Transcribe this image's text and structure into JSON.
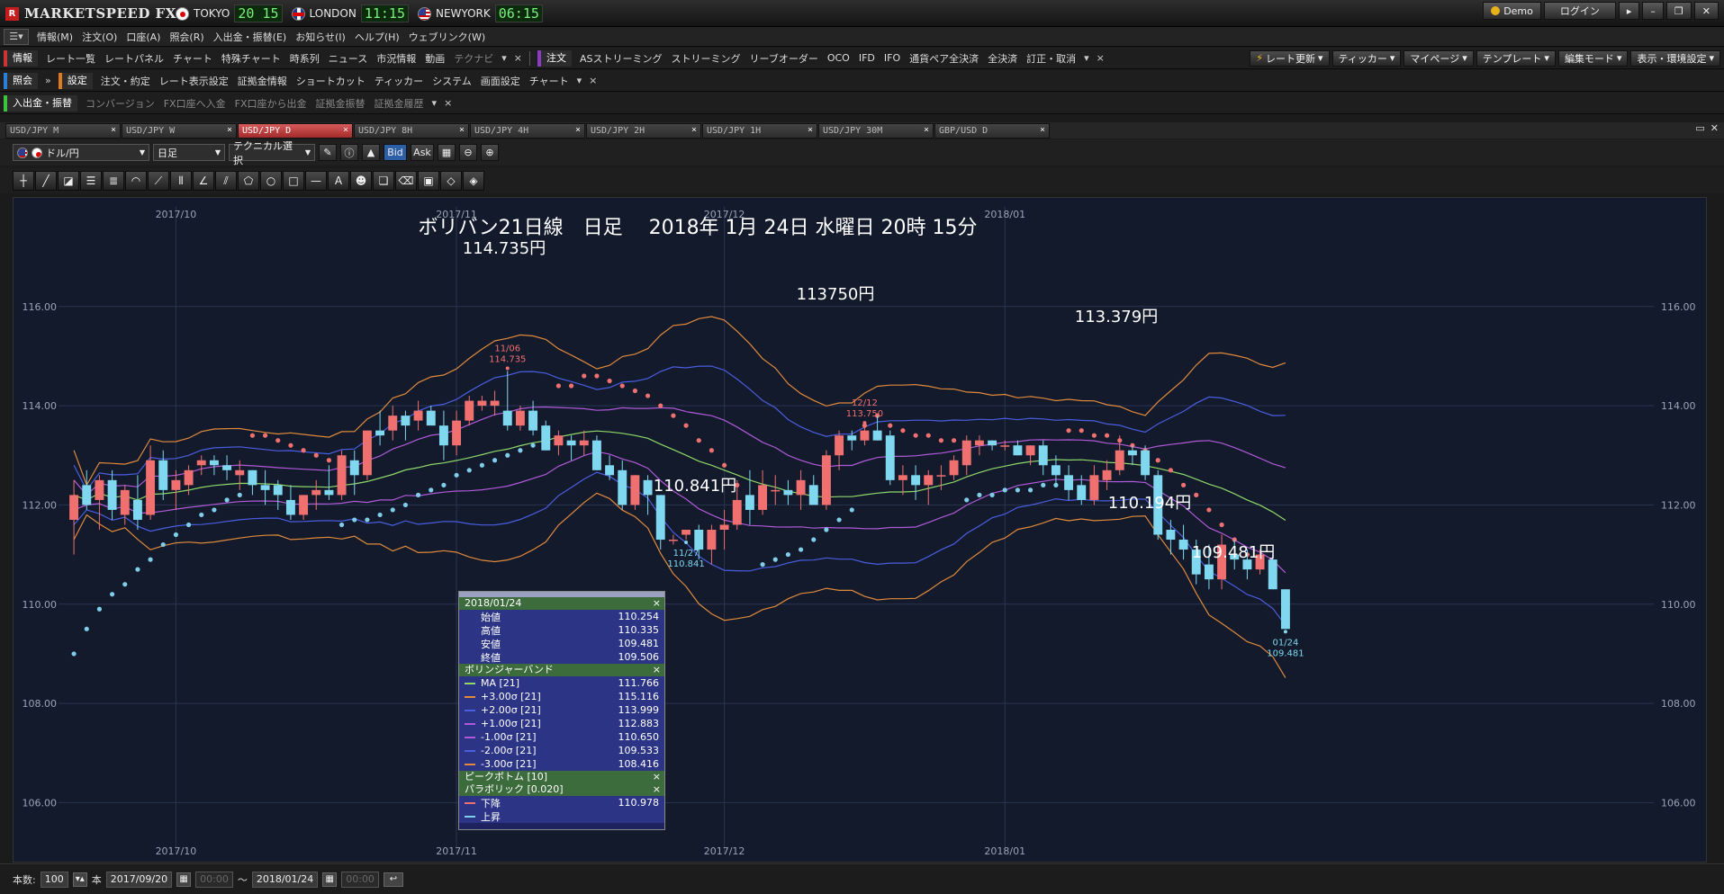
{
  "app": {
    "logo_text": "MARKETSPEED FX",
    "clocks": [
      {
        "name": "TOKYO",
        "time": "20 15"
      },
      {
        "name": "LONDON",
        "time": "11:15"
      },
      {
        "name": "NEWYORK",
        "time": "06:15"
      }
    ],
    "demo_label": "Demo",
    "login_label": "ログイン"
  },
  "menu": [
    "情報(M)",
    "注文(O)",
    "口座(A)",
    "照会(R)",
    "入出金・振替(E)",
    "お知らせ(I)",
    "ヘルプ(H)",
    "ウェブリンク(W)"
  ],
  "toolbar1": {
    "group1_label": "情報",
    "group1_items": [
      "レート一覧",
      "レートパネル",
      "チャート",
      "特殊チャート",
      "時系列",
      "ニュース",
      "市況情報",
      "動画"
    ],
    "group1_dim": "テクナビ",
    "group2_label": "注文",
    "group2_items": [
      "ASストリーミング",
      "ストリーミング",
      "リーブオーダー",
      "OCO",
      "IFD",
      "IFO",
      "通貨ペア全決済",
      "全決済",
      "訂正・取消"
    ],
    "right_buttons": [
      "レート更新",
      "ティッカー",
      "マイページ",
      "テンプレート",
      "編集モード",
      "表示・環境設定"
    ]
  },
  "toolbar2": {
    "group1_label": "照会",
    "group2_label": "設定",
    "group2_items": [
      "注文・約定",
      "レート表示設定",
      "証拠金情報",
      "ショートカット",
      "ティッカー",
      "システム",
      "画面設定",
      "チャート"
    ]
  },
  "toolbar3": {
    "group1_label": "入出金・振替",
    "items": [
      "コンバージョン",
      "FX口座へ入金",
      "FX口座から出金",
      "証拠金振替",
      "証拠金履歴"
    ]
  },
  "tabs": [
    {
      "label": "USD/JPY M",
      "active": false
    },
    {
      "label": "USD/JPY W",
      "active": false
    },
    {
      "label": "USD/JPY D",
      "active": true
    },
    {
      "label": "USD/JPY 8H",
      "active": false
    },
    {
      "label": "USD/JPY 4H",
      "active": false
    },
    {
      "label": "USD/JPY 2H",
      "active": false
    },
    {
      "label": "USD/JPY 1H",
      "active": false
    },
    {
      "label": "USD/JPY 30M",
      "active": false
    },
    {
      "label": "GBP/USD D",
      "active": false
    }
  ],
  "chart_toolbar": {
    "pair": "ドル/円",
    "period": "日足",
    "technical": "テクニカル選択",
    "bid": "Bid",
    "ask": "Ask"
  },
  "status_bar": {
    "count_label": "本数:",
    "count_value": "100",
    "unit": "本",
    "date_from": "2017/09/20",
    "date_to": "2018/01/24",
    "time_from": "00:00",
    "time_to": "00:00",
    "tilde": "〜"
  },
  "data_panel": {
    "date": "2018/01/24",
    "ohlc": [
      {
        "label": "始値",
        "value": "110.254"
      },
      {
        "label": "高値",
        "value": "110.335"
      },
      {
        "label": "安値",
        "value": "109.481"
      },
      {
        "label": "終値",
        "value": "109.506"
      }
    ],
    "bb_title": "ボリンジャーバンド",
    "bb": [
      {
        "label": "MA [21]",
        "value": "111.766",
        "color": "#8fd86a"
      },
      {
        "label": "+3.00σ [21]",
        "value": "115.116",
        "color": "#e08a3c"
      },
      {
        "label": "+2.00σ [21]",
        "value": "113.999",
        "color": "#4a5ee0"
      },
      {
        "label": "+1.00σ [21]",
        "value": "112.883",
        "color": "#b05ad8"
      },
      {
        "label": "-1.00σ [21]",
        "value": "110.650",
        "color": "#b05ad8"
      },
      {
        "label": "-2.00σ [21]",
        "value": "109.533",
        "color": "#4a5ee0"
      },
      {
        "label": "-3.00σ [21]",
        "value": "108.416",
        "color": "#e08a3c"
      }
    ],
    "pb_title": "ピークボトム [10]",
    "sar_title": "パラボリック [0.020]",
    "sar": [
      {
        "label": "下降",
        "value": "110.978",
        "color": "#f07070"
      },
      {
        "label": "上昇",
        "value": "",
        "color": "#7fcde8"
      }
    ]
  },
  "chart_data": {
    "type": "candlestick",
    "title": "ボリバン21日線　日足　 2018年 1月 24日 水曜日 20時 15分",
    "ylim": [
      105.5,
      117.5
    ],
    "yticks": [
      "116.00",
      "114.00",
      "112.00",
      "110.00",
      "108.00",
      "106.00"
    ],
    "xticks": [
      "2017/10",
      "2017/11",
      "2017/12",
      "2018/01"
    ],
    "annotations": [
      {
        "text": "114.735円"
      },
      {
        "text": "113750円"
      },
      {
        "text": "113.379円"
      },
      {
        "text": "110.841円"
      },
      {
        "text": "110.194円"
      },
      {
        "text": "109.481円"
      }
    ],
    "markers": [
      {
        "date": "11/06",
        "value": "114.735"
      },
      {
        "date": "12/12",
        "value": "113.750"
      },
      {
        "date": "11/27",
        "value": "110.841"
      },
      {
        "date": "01/24",
        "value": "109.481"
      }
    ],
    "candles": [
      [
        111.7,
        112.5,
        111.0,
        112.2
      ],
      [
        112.4,
        112.7,
        111.9,
        112.0
      ],
      [
        112.1,
        112.6,
        111.5,
        112.5
      ],
      [
        112.5,
        112.7,
        111.7,
        111.9
      ],
      [
        111.8,
        112.4,
        111.6,
        112.3
      ],
      [
        112.1,
        112.6,
        111.5,
        111.7
      ],
      [
        111.8,
        113.2,
        111.7,
        112.9
      ],
      [
        112.9,
        113.1,
        112.1,
        112.3
      ],
      [
        112.3,
        112.7,
        111.9,
        112.5
      ],
      [
        112.4,
        112.8,
        112.2,
        112.7
      ],
      [
        112.8,
        113.0,
        112.6,
        112.9
      ],
      [
        112.9,
        113.0,
        112.6,
        112.8
      ],
      [
        112.8,
        113.0,
        112.5,
        112.7
      ],
      [
        112.6,
        112.9,
        112.3,
        112.7
      ],
      [
        112.7,
        112.7,
        112.2,
        112.4
      ],
      [
        112.4,
        112.7,
        112.0,
        112.3
      ],
      [
        112.4,
        112.5,
        111.9,
        112.2
      ],
      [
        112.1,
        112.4,
        111.7,
        111.8
      ],
      [
        111.8,
        112.2,
        111.7,
        112.2
      ],
      [
        112.2,
        112.5,
        111.9,
        112.3
      ],
      [
        112.3,
        112.8,
        112.1,
        112.2
      ],
      [
        112.2,
        113.1,
        112.1,
        113.0
      ],
      [
        112.9,
        113.1,
        112.2,
        112.6
      ],
      [
        112.6,
        113.5,
        112.5,
        113.5
      ],
      [
        113.5,
        113.9,
        113.2,
        113.4
      ],
      [
        113.5,
        114.0,
        113.3,
        113.8
      ],
      [
        113.8,
        113.9,
        113.3,
        113.6
      ],
      [
        113.7,
        114.1,
        113.5,
        113.9
      ],
      [
        113.9,
        114.0,
        113.7,
        113.6
      ],
      [
        113.6,
        113.9,
        112.9,
        113.2
      ],
      [
        113.2,
        113.9,
        113.0,
        113.7
      ],
      [
        113.7,
        114.2,
        113.6,
        114.1
      ],
      [
        114.0,
        114.2,
        113.9,
        114.1
      ],
      [
        114.0,
        114.3,
        113.8,
        114.1
      ],
      [
        113.9,
        114.7,
        113.5,
        113.6
      ],
      [
        113.6,
        114.0,
        113.5,
        113.9
      ],
      [
        113.9,
        114.1,
        113.4,
        113.5
      ],
      [
        113.6,
        113.7,
        113.1,
        113.1
      ],
      [
        113.2,
        113.5,
        113.0,
        113.4
      ],
      [
        113.3,
        113.4,
        112.9,
        113.2
      ],
      [
        113.2,
        113.5,
        113.0,
        113.3
      ],
      [
        113.3,
        113.4,
        112.7,
        112.7
      ],
      [
        112.8,
        113.0,
        112.5,
        112.6
      ],
      [
        112.7,
        112.9,
        111.9,
        112.0
      ],
      [
        112.0,
        112.6,
        111.9,
        112.6
      ],
      [
        112.5,
        112.6,
        111.8,
        112.2
      ],
      [
        112.2,
        112.2,
        111.1,
        111.3
      ],
      [
        111.3,
        111.4,
        111.2,
        111.3
      ],
      [
        111.4,
        111.5,
        111.3,
        111.5
      ],
      [
        111.5,
        111.6,
        110.9,
        111.1
      ],
      [
        111.1,
        111.6,
        110.8,
        111.5
      ],
      [
        111.5,
        111.9,
        111.1,
        111.6
      ],
      [
        111.6,
        112.5,
        111.5,
        112.1
      ],
      [
        112.2,
        112.7,
        111.6,
        111.9
      ],
      [
        111.9,
        112.7,
        111.8,
        112.4
      ],
      [
        112.3,
        112.6,
        112.0,
        112.3
      ],
      [
        112.3,
        112.5,
        112.0,
        112.2
      ],
      [
        112.2,
        112.7,
        111.9,
        112.5
      ],
      [
        112.4,
        112.6,
        112.0,
        112.0
      ],
      [
        112.0,
        113.1,
        111.9,
        113.0
      ],
      [
        113.0,
        113.5,
        112.7,
        113.4
      ],
      [
        113.4,
        113.5,
        113.1,
        113.3
      ],
      [
        113.3,
        113.6,
        113.2,
        113.5
      ],
      [
        113.5,
        113.8,
        113.3,
        113.3
      ],
      [
        113.4,
        113.5,
        112.4,
        112.5
      ],
      [
        112.5,
        112.8,
        112.2,
        112.6
      ],
      [
        112.6,
        112.8,
        112.1,
        112.4
      ],
      [
        112.4,
        112.7,
        112.0,
        112.6
      ],
      [
        112.6,
        112.8,
        112.3,
        112.6
      ],
      [
        112.6,
        113.0,
        112.5,
        112.9
      ],
      [
        112.8,
        113.4,
        112.6,
        113.3
      ],
      [
        113.2,
        113.4,
        113.0,
        113.3
      ],
      [
        113.3,
        113.3,
        113.1,
        113.2
      ],
      [
        113.2,
        113.3,
        113.1,
        113.2
      ],
      [
        113.2,
        113.3,
        113.0,
        113.0
      ],
      [
        113.0,
        113.2,
        112.8,
        113.2
      ],
      [
        113.2,
        113.3,
        112.6,
        112.8
      ],
      [
        112.8,
        113.0,
        112.4,
        112.6
      ],
      [
        112.6,
        112.8,
        112.1,
        112.3
      ],
      [
        112.4,
        112.6,
        112.0,
        112.1
      ],
      [
        112.1,
        112.8,
        112.0,
        112.6
      ],
      [
        112.5,
        112.9,
        112.3,
        112.7
      ],
      [
        112.7,
        113.4,
        112.6,
        113.1
      ],
      [
        113.1,
        113.2,
        112.8,
        113.0
      ],
      [
        113.1,
        113.2,
        112.5,
        112.6
      ],
      [
        112.6,
        112.7,
        111.3,
        111.4
      ],
      [
        111.5,
        111.7,
        111.0,
        111.3
      ],
      [
        111.3,
        111.6,
        110.9,
        111.1
      ],
      [
        111.1,
        111.3,
        110.4,
        110.6
      ],
      [
        110.8,
        111.2,
        110.3,
        110.5
      ],
      [
        110.5,
        111.4,
        110.3,
        111.2
      ],
      [
        111.0,
        111.3,
        110.7,
        110.9
      ],
      [
        110.9,
        111.1,
        110.5,
        110.7
      ],
      [
        110.7,
        111.1,
        110.6,
        111.0
      ],
      [
        110.9,
        111.0,
        110.3,
        110.3
      ],
      [
        110.3,
        110.3,
        109.5,
        109.5
      ]
    ],
    "sar_points": [
      [
        0,
        109.0
      ],
      [
        1,
        109.5
      ],
      [
        2,
        109.9
      ],
      [
        3,
        110.2
      ],
      [
        4,
        110.4
      ],
      [
        5,
        110.7
      ],
      [
        6,
        110.9
      ],
      [
        7,
        111.2
      ],
      [
        8,
        111.4
      ],
      [
        9,
        111.6
      ],
      [
        10,
        111.8
      ],
      [
        11,
        111.9
      ],
      [
        12,
        112.1
      ],
      [
        13,
        112.2
      ],
      [
        14,
        113.4
      ],
      [
        15,
        113.4
      ],
      [
        16,
        113.3
      ],
      [
        17,
        113.2
      ],
      [
        18,
        113.1
      ],
      [
        19,
        113.0
      ],
      [
        20,
        112.9
      ],
      [
        21,
        111.6
      ],
      [
        22,
        111.7
      ],
      [
        23,
        111.7
      ],
      [
        24,
        111.8
      ],
      [
        25,
        111.9
      ],
      [
        26,
        112.0
      ],
      [
        27,
        112.2
      ],
      [
        28,
        112.3
      ],
      [
        29,
        112.4
      ],
      [
        30,
        112.6
      ],
      [
        31,
        112.7
      ],
      [
        32,
        112.8
      ],
      [
        33,
        112.9
      ],
      [
        34,
        113.0
      ],
      [
        35,
        113.1
      ],
      [
        36,
        113.2
      ],
      [
        37,
        113.4
      ],
      [
        38,
        114.4
      ],
      [
        39,
        114.4
      ],
      [
        40,
        114.6
      ],
      [
        41,
        114.6
      ],
      [
        42,
        114.5
      ],
      [
        43,
        114.4
      ],
      [
        44,
        114.3
      ],
      [
        45,
        114.2
      ],
      [
        46,
        114.0
      ],
      [
        47,
        113.8
      ],
      [
        48,
        113.6
      ],
      [
        49,
        113.3
      ],
      [
        50,
        113.1
      ],
      [
        51,
        112.8
      ],
      [
        52,
        112.4
      ],
      [
        53,
        112.1
      ],
      [
        54,
        110.8
      ],
      [
        55,
        110.9
      ],
      [
        56,
        111.0
      ],
      [
        57,
        111.1
      ],
      [
        58,
        111.3
      ],
      [
        59,
        111.5
      ],
      [
        60,
        111.7
      ],
      [
        61,
        111.9
      ],
      [
        62,
        113.6
      ],
      [
        63,
        113.8
      ],
      [
        64,
        113.6
      ],
      [
        65,
        113.5
      ],
      [
        66,
        113.4
      ],
      [
        67,
        113.4
      ],
      [
        68,
        113.3
      ],
      [
        69,
        113.3
      ],
      [
        70,
        112.1
      ],
      [
        71,
        112.2
      ],
      [
        72,
        112.2
      ],
      [
        73,
        112.3
      ],
      [
        74,
        112.3
      ],
      [
        75,
        112.3
      ],
      [
        76,
        112.4
      ],
      [
        77,
        112.4
      ],
      [
        78,
        113.5
      ],
      [
        79,
        113.5
      ],
      [
        80,
        113.4
      ],
      [
        81,
        113.4
      ],
      [
        82,
        113.3
      ],
      [
        83,
        113.2
      ],
      [
        84,
        113.1
      ],
      [
        85,
        112.9
      ],
      [
        86,
        112.7
      ],
      [
        87,
        112.4
      ],
      [
        88,
        112.2
      ],
      [
        89,
        111.9
      ],
      [
        90,
        111.6
      ],
      [
        91,
        111.3
      ],
      [
        92,
        111.0
      ]
    ]
  }
}
